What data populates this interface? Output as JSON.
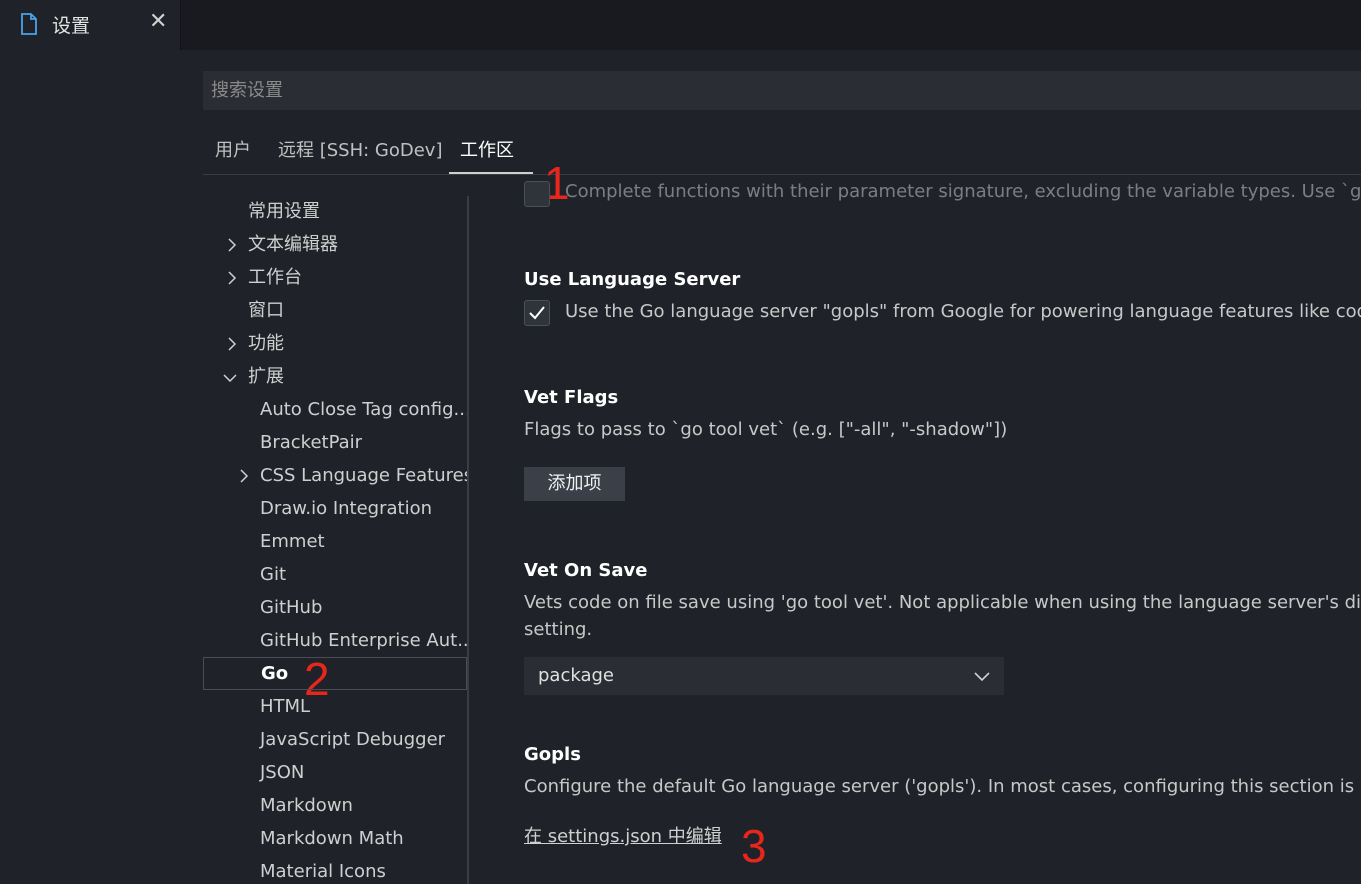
{
  "tab": {
    "label": "设置"
  },
  "search": {
    "placeholder": "搜索设置"
  },
  "scope_tabs": [
    "用户",
    "远程 [SSH: GoDev]",
    "工作区"
  ],
  "annotations": [
    "1",
    "2",
    "3"
  ],
  "toc": [
    {
      "label": "常用设置"
    },
    {
      "label": "文本编辑器"
    },
    {
      "label": "工作台"
    },
    {
      "label": "窗口"
    },
    {
      "label": "功能"
    },
    {
      "label": "扩展"
    },
    {
      "label": "Auto Close Tag config..."
    },
    {
      "label": "BracketPair"
    },
    {
      "label": "CSS Language Features"
    },
    {
      "label": "Draw.io Integration"
    },
    {
      "label": "Emmet"
    },
    {
      "label": "Git"
    },
    {
      "label": "GitHub"
    },
    {
      "label": "GitHub Enterprise Aut..."
    },
    {
      "label": "Go"
    },
    {
      "label": "HTML"
    },
    {
      "label": "JavaScript Debugger"
    },
    {
      "label": "JSON"
    },
    {
      "label": "Markdown"
    },
    {
      "label": "Markdown Math"
    },
    {
      "label": "Material Icons"
    }
  ],
  "settings": {
    "top_partial_desc": "Complete functions with their parameter signature, excluding the variable types. Use `gopls.u",
    "use_language_server": {
      "title": "Use Language Server",
      "desc": "Use the Go language server \"gopls\" from Google for powering language features like code na",
      "checked": true
    },
    "vet_flags": {
      "title": "Vet Flags",
      "desc": "Flags to pass to `go tool vet` (e.g. [\"-all\", \"-shadow\"])",
      "button": "添加项"
    },
    "vet_on_save": {
      "title": "Vet On Save",
      "desc_line1": "Vets code on file save using 'go tool vet'. Not applicable when using the language server's diagno",
      "desc_line2": "setting.",
      "value": "package"
    },
    "gopls": {
      "title": "Gopls",
      "desc": "Configure the default Go language server ('gopls'). In most cases, configuring this section is unnec",
      "link": "在 settings.json 中编辑"
    }
  },
  "colors": {
    "annotation": "#e8261c",
    "background": "#1f2329"
  }
}
